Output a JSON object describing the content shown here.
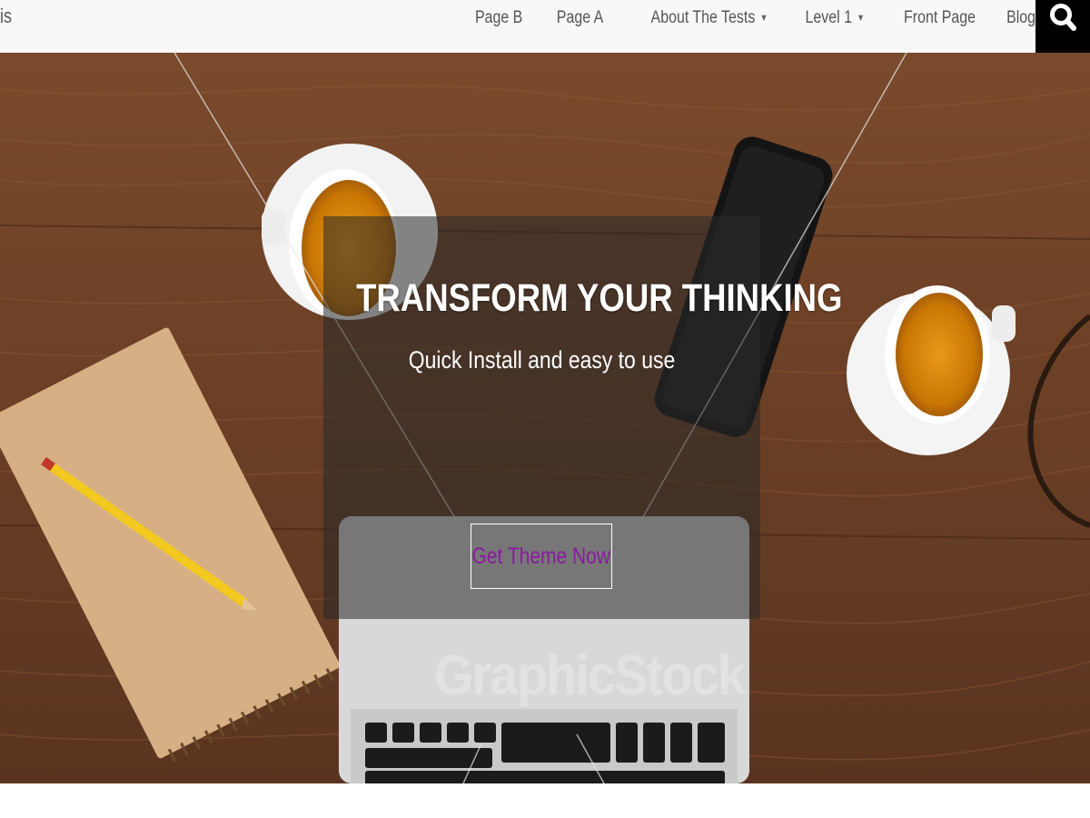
{
  "site": {
    "title_fragment": "is"
  },
  "nav": {
    "items": [
      {
        "label": "Page B",
        "has_dropdown": false
      },
      {
        "label": "Page A",
        "has_dropdown": false
      },
      {
        "label": "About The Tests",
        "has_dropdown": true
      },
      {
        "label": "Level 1",
        "has_dropdown": true
      },
      {
        "label": "Front Page",
        "has_dropdown": false
      },
      {
        "label": "Blog",
        "has_dropdown": false
      }
    ],
    "dropdown_glyph": "▼",
    "search_icon": "search-icon"
  },
  "hero": {
    "title": "TRANSFORM YOUR THINKING",
    "subtitle": "Quick Install and easy to use",
    "cta_label": "Get Theme Now",
    "watermark": "GraphicStock"
  },
  "colors": {
    "nav_bg": "#f8f8f8",
    "nav_text": "#555555",
    "search_bg": "#000000",
    "overlay": "rgba(40,40,40,0.55)",
    "cta_text": "#8a1aa0",
    "wood": "#6e442a"
  }
}
